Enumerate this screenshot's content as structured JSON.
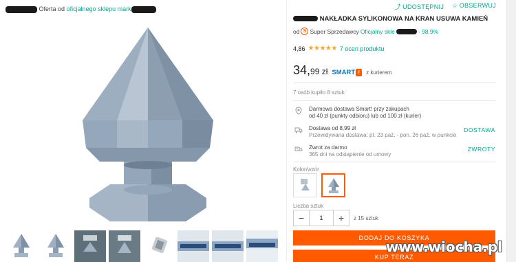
{
  "header": {
    "offer_prefix": "Oferta od",
    "offer_link": "oficjalnego sklepu mark"
  },
  "actions": {
    "share": "UDOSTĘPNIJ",
    "watch": "OBSERWUJ"
  },
  "product": {
    "title": "NAKŁADKA SYLIKONOWA NA KRAN USUWA KAMIEŃ",
    "seller_prefix": "od",
    "seller_super": "Super Sprzedawcy",
    "seller_official": "Oficjalny skle",
    "seller_rating": "- 98,9%",
    "rating_value": "4,86",
    "stars": "★★★★★",
    "ratings_count": "7 ocen produktu",
    "rating_out_of_5": 4.86
  },
  "price": {
    "main": "34,",
    "cents": "99 zł",
    "smart_label": "SMART",
    "courier": "z kurierem"
  },
  "purchase": {
    "bought": "7 osób kupiło 8 sztuk"
  },
  "info": [
    {
      "line1": "Darmowa dostawa Smart! przy zakupach",
      "line2": "od 40 zł (punkty odbioru) lub od 100 zł (kurier)",
      "tag": "",
      "icon": "location-icon"
    },
    {
      "line1": "Dostawa od 8,99 zł",
      "line2": "Przewidywana dostawa: pt. 23 paź. - pon. 26 paź. w punkcie",
      "tag": "DOSTAWA",
      "icon": "truck-icon"
    },
    {
      "line1": "Zwrot za darmo",
      "line2": "365 dni na odstąpienie od umowy",
      "tag": "ZWROTY",
      "icon": "return-truck-icon"
    }
  ],
  "variants": {
    "label": "Kolor/wzór"
  },
  "quantity": {
    "label": "Liczba sztuk",
    "value": "1",
    "minus": "−",
    "plus": "+",
    "of": "z 15 sztuk"
  },
  "buttons": {
    "add_to_cart": "DODAJ DO KOSZYKA",
    "buy_now": "KUP TERAZ"
  },
  "watermark": "www.wiocha.pl",
  "colors": {
    "accent": "#ff5a00",
    "teal": "#00a790",
    "smart": "#0077c0",
    "product": "#9aabbd"
  }
}
